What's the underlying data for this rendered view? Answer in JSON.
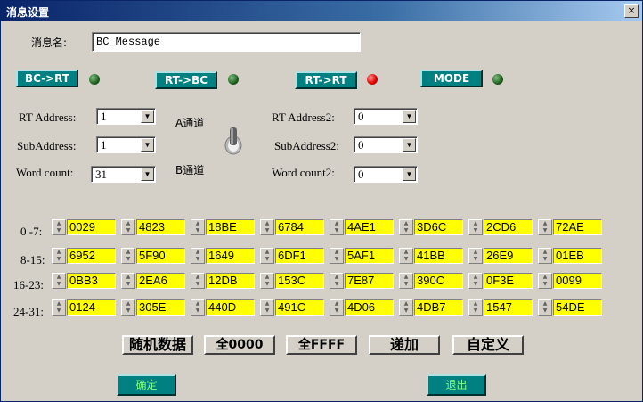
{
  "window": {
    "title": "消息设置",
    "close_label": "×"
  },
  "message_name": {
    "label": "消息名:",
    "value": "BC_Message"
  },
  "modes": [
    {
      "label": "BC->RT",
      "led": "green"
    },
    {
      "label": "RT->BC",
      "led": "green"
    },
    {
      "label": "RT->RT",
      "led": "red"
    },
    {
      "label": "MODE",
      "led": "green"
    }
  ],
  "left_fields": [
    {
      "label": "RT Address:",
      "value": "1"
    },
    {
      "label": "SubAddress:",
      "value": "1"
    },
    {
      "label": "Word count:",
      "value": "31"
    }
  ],
  "right_fields": [
    {
      "label": "RT Address2:",
      "value": "0"
    },
    {
      "label": "SubAddress2:",
      "value": "0"
    },
    {
      "label": "Word count2:",
      "value": "0"
    }
  ],
  "channels": {
    "a": "A通道",
    "b": "B通道"
  },
  "rows": [
    {
      "label": "0 -7:",
      "words": [
        "0029",
        "4823",
        "18BE",
        "6784",
        "4AE1",
        "3D6C",
        "2CD6",
        "72AE"
      ]
    },
    {
      "label": "8-15:",
      "words": [
        "6952",
        "5F90",
        "1649",
        "6DF1",
        "5AF1",
        "41BB",
        "26E9",
        "01EB"
      ]
    },
    {
      "label": "16-23:",
      "words": [
        "0BB3",
        "2EA6",
        "12DB",
        "153C",
        "7E87",
        "390C",
        "0F3E",
        "0099"
      ]
    },
    {
      "label": "24-31:",
      "words": [
        "0124",
        "305E",
        "440D",
        "491C",
        "4D06",
        "4DB7",
        "1547",
        "54DE"
      ]
    }
  ],
  "actions": {
    "random": "随机数据",
    "all0": "全0000",
    "allF": "全FFFF",
    "increment": "递加",
    "custom": "自定义"
  },
  "footer": {
    "ok": "确定",
    "exit": "退出"
  },
  "colors": {
    "led_green": "#1f5f1f",
    "led_red": "#e00000",
    "word_bg": "#ffff00",
    "mode_btn": "#008080"
  }
}
